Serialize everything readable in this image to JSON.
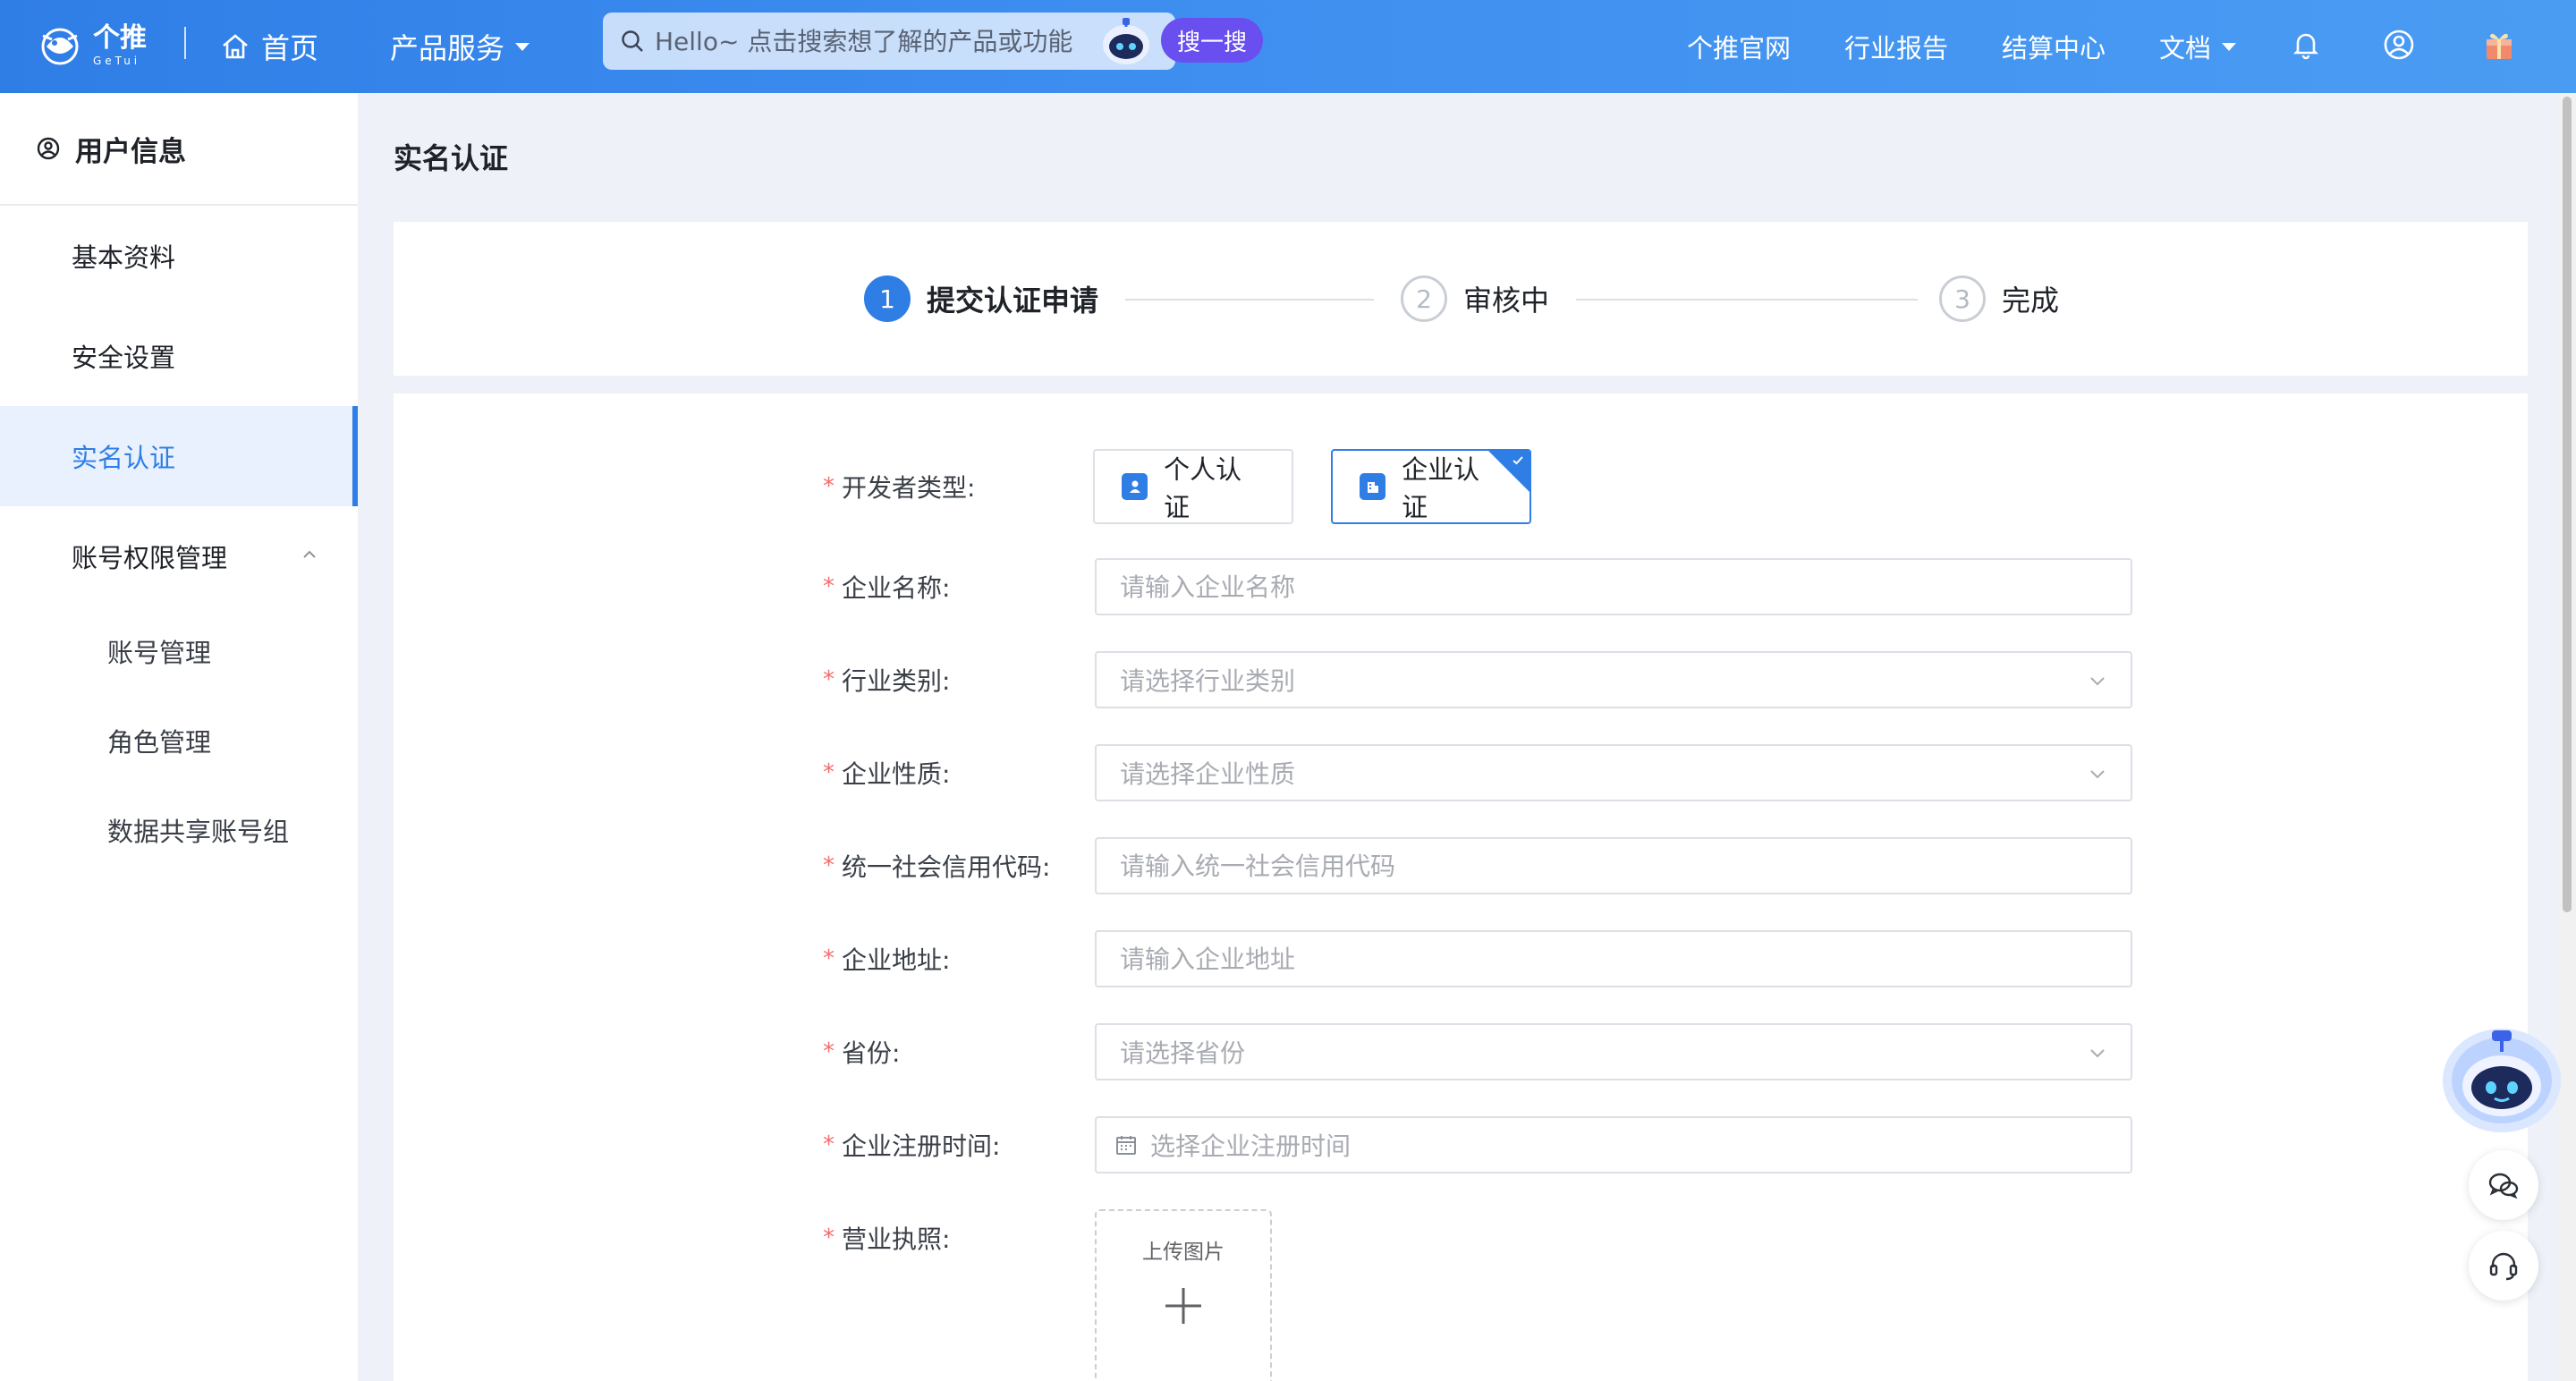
{
  "header": {
    "brand_cn": "个推",
    "brand_en": "GeTui",
    "home_label": "首页",
    "products_label": "产品服务",
    "search_placeholder": "Hello~ 点击搜索想了解的产品或功能",
    "search_button": "搜一搜",
    "links": [
      "个推官网",
      "行业报告",
      "结算中心",
      "文档"
    ],
    "icons": [
      "bell-icon",
      "user-avatar-icon",
      "gift-icon"
    ]
  },
  "sidebar": {
    "title": "用户信息",
    "items": [
      {
        "label": "基本资料",
        "active": false
      },
      {
        "label": "安全设置",
        "active": false
      },
      {
        "label": "实名认证",
        "active": true
      },
      {
        "label": "账号权限管理",
        "active": false,
        "expanded": true
      }
    ],
    "sub_items": [
      "账号管理",
      "角色管理",
      "数据共享账号组"
    ]
  },
  "main": {
    "title": "实名认证",
    "steps": [
      {
        "number": "1",
        "label": "提交认证申请",
        "active": true
      },
      {
        "number": "2",
        "label": "审核中",
        "active": false
      },
      {
        "number": "3",
        "label": "完成",
        "active": false
      }
    ]
  },
  "form": {
    "required_mark": "*",
    "developer_type_label": "开发者类型:",
    "type_personal": "个人认证",
    "type_enterprise": "企业认证",
    "selected_type": "企业认证",
    "fields": [
      {
        "label": "企业名称:",
        "placeholder": "请输入企业名称",
        "kind": "input"
      },
      {
        "label": "行业类别:",
        "placeholder": "请选择行业类别",
        "kind": "select"
      },
      {
        "label": "企业性质:",
        "placeholder": "请选择企业性质",
        "kind": "select"
      },
      {
        "label": "统一社会信用代码:",
        "placeholder": "请输入统一社会信用代码",
        "kind": "input"
      },
      {
        "label": "企业地址:",
        "placeholder": "请输入企业地址",
        "kind": "input"
      },
      {
        "label": "省份:",
        "placeholder": "请选择省份",
        "kind": "select"
      },
      {
        "label": "企业注册时间:",
        "placeholder": "选择企业注册时间",
        "kind": "date"
      }
    ],
    "license_label": "营业执照:",
    "upload_label": "上传图片"
  },
  "colors": {
    "primary": "#2f7ee6",
    "required": "#f56c6c",
    "header_gradient_start": "#2f7ee6",
    "header_gradient_end": "#4a9cf2"
  }
}
